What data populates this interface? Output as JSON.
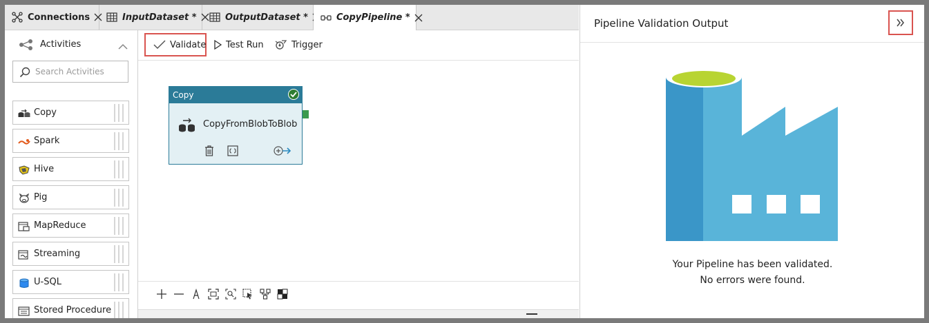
{
  "tabs": [
    {
      "label": "Connections",
      "italic": false,
      "active": false,
      "icon": "connections-icon"
    },
    {
      "label": "InputDataset *",
      "italic": true,
      "active": false,
      "icon": "table-icon"
    },
    {
      "label": "OutputDataset *",
      "italic": true,
      "active": false,
      "icon": "table-icon"
    },
    {
      "label": "CopyPipeline *",
      "italic": true,
      "active": true,
      "icon": "pipeline-icon"
    }
  ],
  "sidebar": {
    "title": "Activities",
    "search_placeholder": "Search Activities",
    "items": [
      {
        "label": "Copy",
        "icon": "copy-activity-icon"
      },
      {
        "label": "Spark",
        "icon": "spark-icon"
      },
      {
        "label": "Hive",
        "icon": "hive-icon"
      },
      {
        "label": "Pig",
        "icon": "pig-icon"
      },
      {
        "label": "MapReduce",
        "icon": "mapreduce-icon"
      },
      {
        "label": "Streaming",
        "icon": "streaming-icon"
      },
      {
        "label": "U-SQL",
        "icon": "usql-icon"
      },
      {
        "label": "Stored Procedure",
        "icon": "stored-procedure-icon"
      }
    ]
  },
  "toolbar": {
    "validate_label": "Validate",
    "test_run_label": "Test Run",
    "trigger_label": "Trigger"
  },
  "node": {
    "type_label": "Copy",
    "name": "CopyFromBlobToBlob",
    "status": "valid"
  },
  "panel": {
    "title": "Pipeline Validation Output",
    "message_line1": "Your Pipeline has been validated.",
    "message_line2": "No errors were found."
  },
  "colors": {
    "accent": "#2b7b98",
    "highlight_border": "#d9534f",
    "success": "#3a9a4e",
    "factory_dark": "#3a96c8",
    "factory_light": "#59b4d9",
    "factory_top": "#b8d432"
  }
}
